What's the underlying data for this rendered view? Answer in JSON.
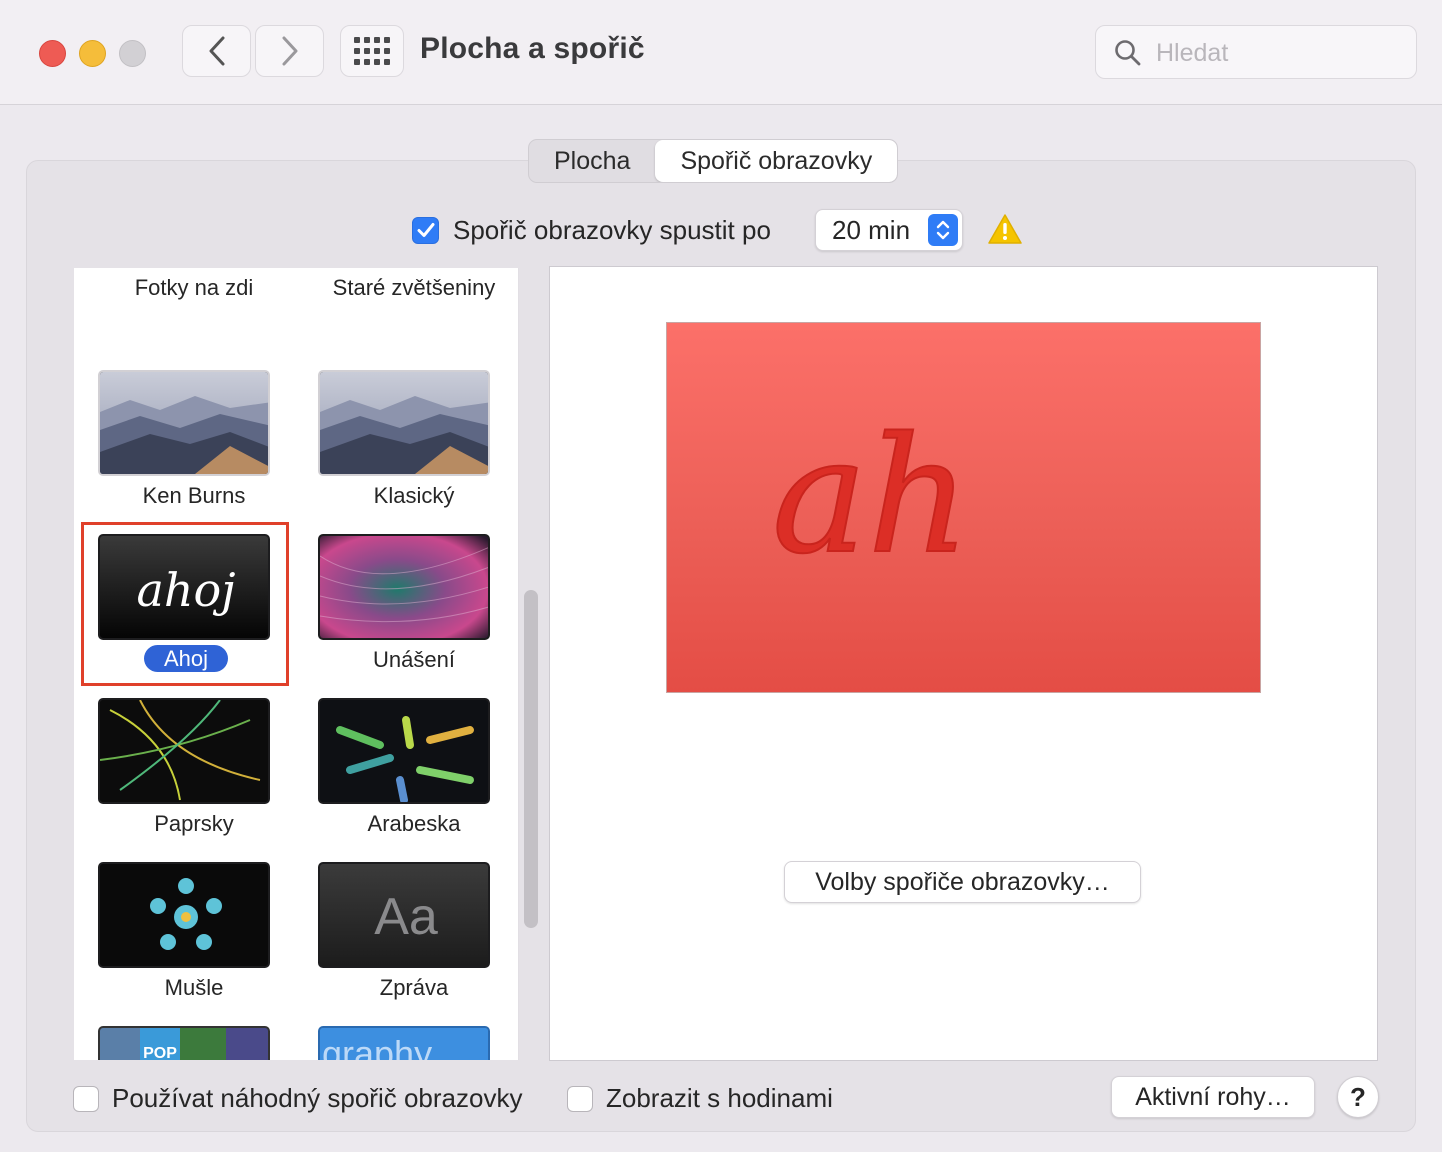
{
  "window": {
    "title": "Plocha a spořič",
    "search_placeholder": "Hledat"
  },
  "tabs": [
    {
      "label": "Plocha",
      "active": false
    },
    {
      "label": "Spořič obrazovky",
      "active": true
    }
  ],
  "start_after": {
    "checked": true,
    "label": "Spořič obrazovky spustit po",
    "value": "20 min"
  },
  "screensavers": [
    {
      "label": "Fotky na zdi",
      "icon": "photo-wall-thumbnail"
    },
    {
      "label": "Staré zvětšeniny",
      "icon": "vintage-prints-thumbnail"
    },
    {
      "label": "Ken Burns",
      "icon": "mountains-thumbnail"
    },
    {
      "label": "Klasický",
      "icon": "mountains-thumbnail"
    },
    {
      "label": "Ahoj",
      "icon": "ahoj-thumbnail",
      "thumb_text": "ahoj",
      "selected": true
    },
    {
      "label": "Unášení",
      "icon": "drift-thumbnail"
    },
    {
      "label": "Paprsky",
      "icon": "flurry-thumbnail"
    },
    {
      "label": "Arabeska",
      "icon": "arabesque-thumbnail"
    },
    {
      "label": "Mušle",
      "icon": "shell-thumbnail"
    },
    {
      "label": "Zpráva",
      "icon": "message-thumbnail",
      "thumb_text": "Aa"
    },
    {
      "label": "",
      "icon": "album-artwork-thumbnail",
      "thumb_text": "POP"
    },
    {
      "label": "",
      "icon": "word-of-the-day-thumbnail",
      "thumb_text": "graphy"
    }
  ],
  "preview": {
    "text": "ah",
    "background": "#f0635c",
    "options_button": "Volby spořiče obrazovky…"
  },
  "footer": {
    "random_checkbox": {
      "checked": false,
      "label": "Používat náhodný spořič obrazovky"
    },
    "clock_checkbox": {
      "checked": false,
      "label": "Zobrazit s hodinami"
    },
    "hot_corners_button": "Aktivní rohy…",
    "help_button": "?"
  },
  "colors": {
    "accent": "#2f7cf6",
    "selection_outline": "#e0402a",
    "warning": "#f5c400"
  }
}
